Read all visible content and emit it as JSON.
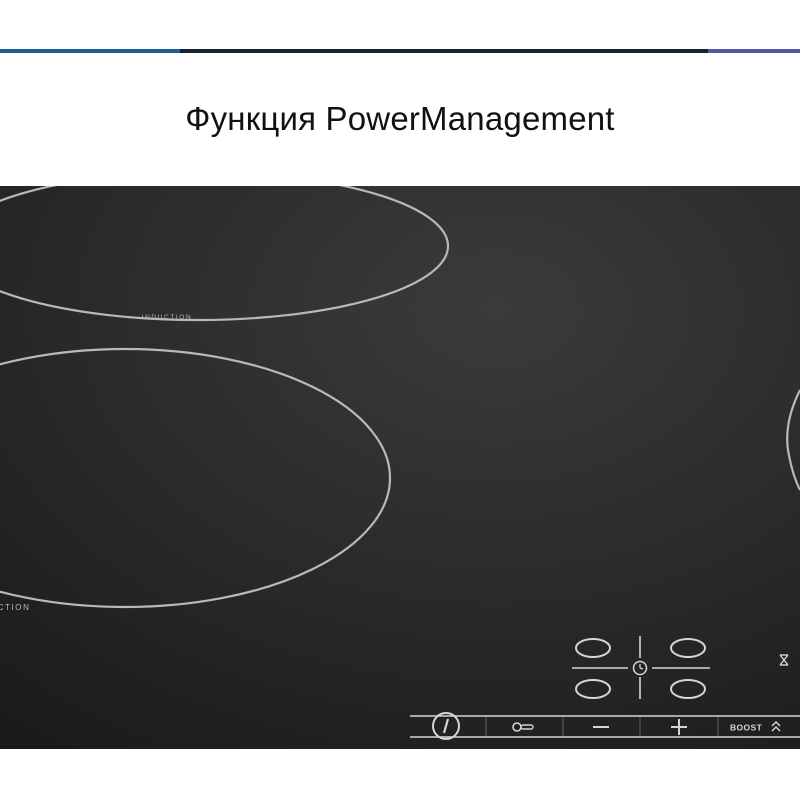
{
  "page": {
    "title": "Функция PowerManagement"
  },
  "colors": {
    "bar_left": "#1d5d8f",
    "bar_middle": "#152232",
    "bar_right": "#5656a8",
    "glass_dark": "#1b1b1d",
    "glass_light": "#3b3b3d",
    "ring_line": "#b9b9bb",
    "control_line": "#d6d6d8"
  },
  "hob": {
    "zone_label_top": "INDUCTION",
    "zone_label_left": "CTION",
    "controls": {
      "power_icon": "power-icon",
      "lock_icon": "key-lock-icon",
      "minus_icon": "minus-icon",
      "plus_icon": "plus-icon",
      "boost_label": "BOOST",
      "boost_icon": "double-chevron-up-icon",
      "timer_icon": "timer-icon",
      "zone_selector_icon": "zone-selector-icon"
    }
  }
}
